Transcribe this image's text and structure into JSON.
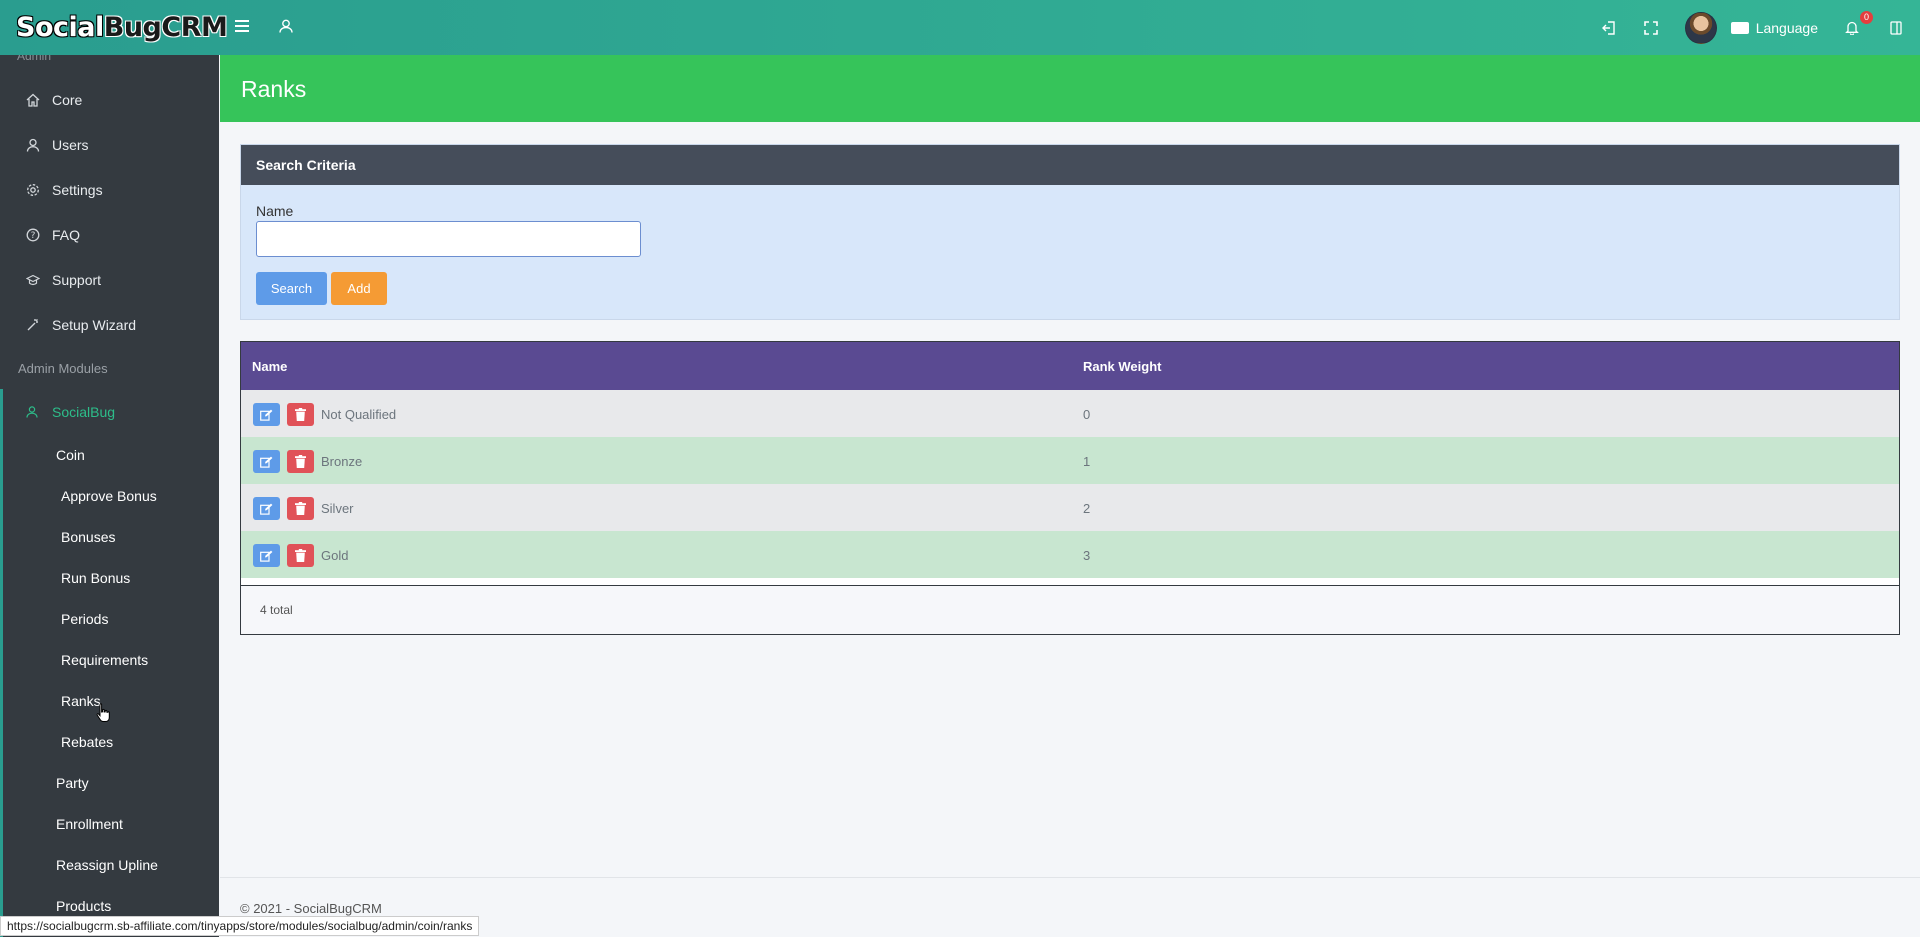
{
  "brand": {
    "part1": "Social",
    "part2": "Bug",
    "part3": "CRM"
  },
  "header": {
    "language_label": "Language",
    "notification_count": "0"
  },
  "sidebar": {
    "partial_label": "Admin",
    "items": [
      {
        "label": "Core",
        "icon": "home-icon"
      },
      {
        "label": "Users",
        "icon": "user-icon"
      },
      {
        "label": "Settings",
        "icon": "gear-icon"
      },
      {
        "label": "FAQ",
        "icon": "help-circle-icon"
      },
      {
        "label": "Support",
        "icon": "support-icon"
      },
      {
        "label": "Setup Wizard",
        "icon": "wand-icon"
      }
    ],
    "section_label": "Admin Modules",
    "module_label": "SocialBug",
    "submodule_label": "Coin",
    "coin_items": [
      "Approve Bonus",
      "Bonuses",
      "Run Bonus",
      "Periods",
      "Requirements",
      "Ranks",
      "Rebates"
    ],
    "module_items": [
      "Party",
      "Enrollment",
      "Reassign Upline",
      "Products"
    ]
  },
  "page": {
    "title": "Ranks"
  },
  "search": {
    "heading": "Search Criteria",
    "name_label": "Name",
    "name_value": "",
    "search_button": "Search",
    "add_button": "Add"
  },
  "table": {
    "columns": [
      "Name",
      "Rank Weight"
    ],
    "rows": [
      {
        "name": "Not Qualified",
        "weight": "0"
      },
      {
        "name": "Bronze",
        "weight": "1"
      },
      {
        "name": "Silver",
        "weight": "2"
      },
      {
        "name": "Gold",
        "weight": "3"
      }
    ],
    "total_label": "4 total"
  },
  "footer": {
    "copyright": "© 2021 - SocialBugCRM"
  },
  "statusbar": {
    "url": "https://socialbugcrm.sb-affiliate.com/tinyapps/store/modules/socialbug/admin/coin/ranks"
  },
  "colors": {
    "header": "#2a9d8f",
    "sidebar": "#343a40",
    "content_header": "#36c45a",
    "table_header": "#5a4a92",
    "active_link": "#2dbd8a"
  }
}
